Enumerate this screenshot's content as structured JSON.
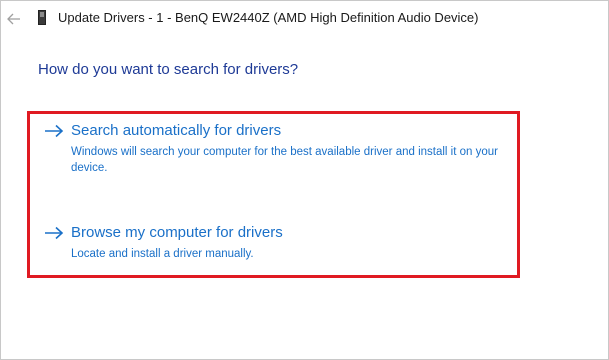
{
  "window": {
    "title": "Update Drivers - 1 - BenQ EW2440Z (AMD High Definition Audio Device)"
  },
  "icons": {
    "back": "back-arrow-icon",
    "device": "device-icon",
    "option_arrow": "right-arrow-icon"
  },
  "heading": "How do you want to search for drivers?",
  "options": [
    {
      "title": "Search automatically for drivers",
      "description": "Windows will search your computer for the best available driver and install it on your device."
    },
    {
      "title": "Browse my computer for drivers",
      "description": "Locate and install a driver manually."
    }
  ],
  "colors": {
    "heading": "#1e3a96",
    "link": "#1a70c8",
    "highlight_border": "#e01a22"
  }
}
